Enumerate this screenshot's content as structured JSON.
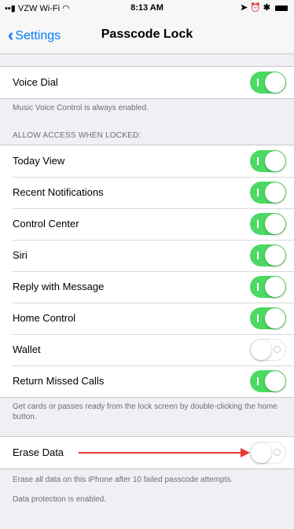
{
  "status_bar": {
    "carrier": "VZW Wi-Fi",
    "time": "8:13 AM"
  },
  "nav": {
    "back_label": "Settings",
    "title": "Passcode Lock"
  },
  "voice_dial": {
    "label": "Voice Dial",
    "enabled": true,
    "note": "Music Voice Control is always enabled."
  },
  "access_section": {
    "header": "ALLOW ACCESS WHEN LOCKED:",
    "items": [
      {
        "label": "Today View",
        "enabled": true
      },
      {
        "label": "Recent Notifications",
        "enabled": true
      },
      {
        "label": "Control Center",
        "enabled": true
      },
      {
        "label": "Siri",
        "enabled": true
      },
      {
        "label": "Reply with Message",
        "enabled": true
      },
      {
        "label": "Home Control",
        "enabled": true
      },
      {
        "label": "Wallet",
        "enabled": false
      },
      {
        "label": "Return Missed Calls",
        "enabled": true
      }
    ],
    "note": "Get cards or passes ready from the lock screen by double-clicking the home button."
  },
  "erase_data": {
    "label": "Erase Data",
    "enabled": false,
    "note1": "Erase all data on this iPhone after 10 failed passcode attempts.",
    "note2": "Data protection is enabled."
  },
  "colors": {
    "accent": "#007aff",
    "toggle_on": "#4cd964",
    "annotation_arrow": "#e53935"
  }
}
